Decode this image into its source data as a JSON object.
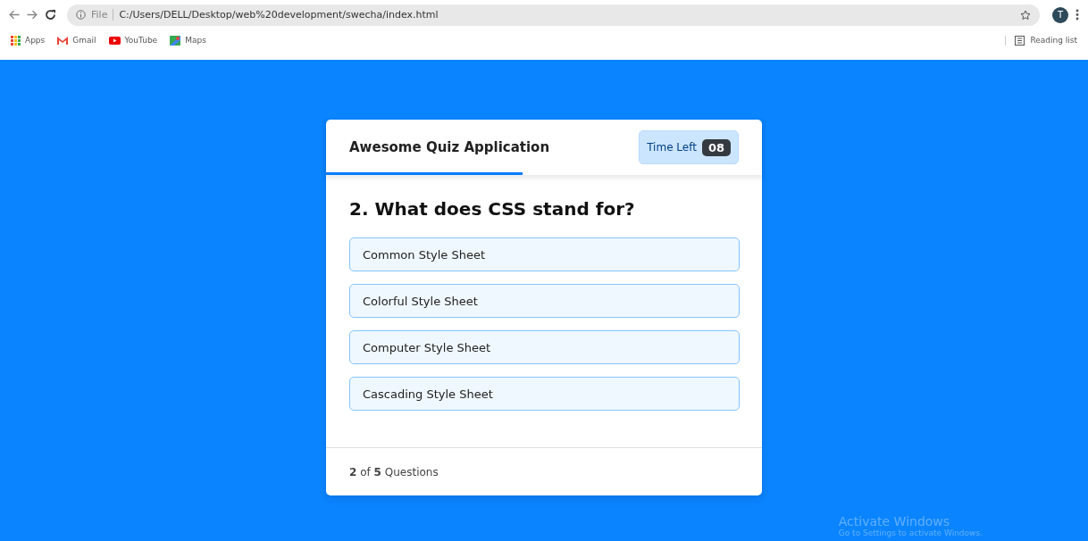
{
  "browser": {
    "url_prefix": "File",
    "url": "C:/Users/DELL/Desktop/web%20development/swecha/index.html",
    "profile_initial": "T",
    "bookmarks": [
      {
        "label": "Apps",
        "kind": "apps"
      },
      {
        "label": "Gmail",
        "kind": "gmail"
      },
      {
        "label": "YouTube",
        "kind": "youtube"
      },
      {
        "label": "Maps",
        "kind": "maps"
      }
    ],
    "reading_list": "Reading list"
  },
  "quiz": {
    "title": "Awesome Quiz Application",
    "timer_label": "Time Left",
    "timer_value": "08",
    "time_line": {
      "level": 0.45
    },
    "question": "2. What does CSS stand for?",
    "options": [
      {
        "label": "Common Style Sheet",
        "selected": false
      },
      {
        "label": "Colorful Style Sheet",
        "selected": false
      },
      {
        "label": "Computer Style Sheet",
        "selected": false
      },
      {
        "label": "Cascading Style Sheet",
        "selected": false
      }
    ],
    "footer": "**2** of **5** Questions"
  },
  "os_notice": {
    "title": "Activate Windows",
    "text": "Go to Settings to activate Windows."
  }
}
